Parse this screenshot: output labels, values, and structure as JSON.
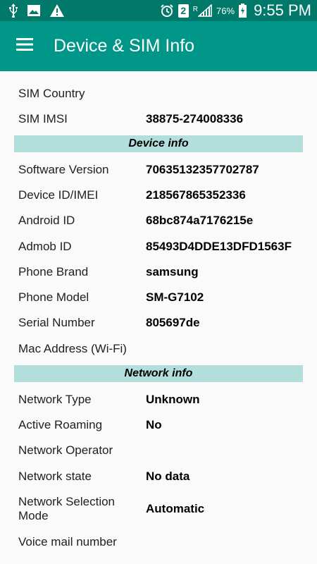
{
  "status_bar": {
    "icons_left": [
      "usb-icon",
      "image-icon",
      "warning-icon"
    ],
    "sim_number": "2",
    "roaming_indicator": "R",
    "battery_percent": "76%",
    "time": "9:55 PM"
  },
  "toolbar": {
    "title": "Device & SIM Info",
    "menu_icon": "hamburger-menu-icon"
  },
  "sim": {
    "rows": [
      {
        "label": "SIM Country",
        "value": ""
      },
      {
        "label": "SIM IMSI",
        "value": "38875-274008336"
      }
    ]
  },
  "device": {
    "header": "Device info",
    "rows": [
      {
        "label": "Software Version",
        "value": "70635132357702787"
      },
      {
        "label": "Device ID/IMEI",
        "value": "218567865352336"
      },
      {
        "label": "Android ID",
        "value": "68bc874a7176215e"
      },
      {
        "label": "Admob ID",
        "value": "85493D4DDE13DFD1563F"
      },
      {
        "label": "Phone Brand",
        "value": "samsung"
      },
      {
        "label": "Phone Model",
        "value": "SM-G7102"
      },
      {
        "label": "Serial Number",
        "value": "805697de"
      },
      {
        "label": "Mac Address (Wi-Fi)",
        "value": ""
      }
    ]
  },
  "network": {
    "header": "Network info",
    "rows": [
      {
        "label": "Network Type",
        "value": "Unknown"
      },
      {
        "label": "Active Roaming",
        "value": "No"
      },
      {
        "label": "Network Operator",
        "value": ""
      },
      {
        "label": "Network state",
        "value": "No data"
      },
      {
        "label": "Network Selection Mode",
        "value": "Automatic"
      },
      {
        "label": "Voice mail number",
        "value": ""
      }
    ]
  },
  "colors": {
    "status_bar": "#00796b",
    "toolbar": "#009688",
    "section_header": "#b2dfdb",
    "background": "#fafafa"
  }
}
